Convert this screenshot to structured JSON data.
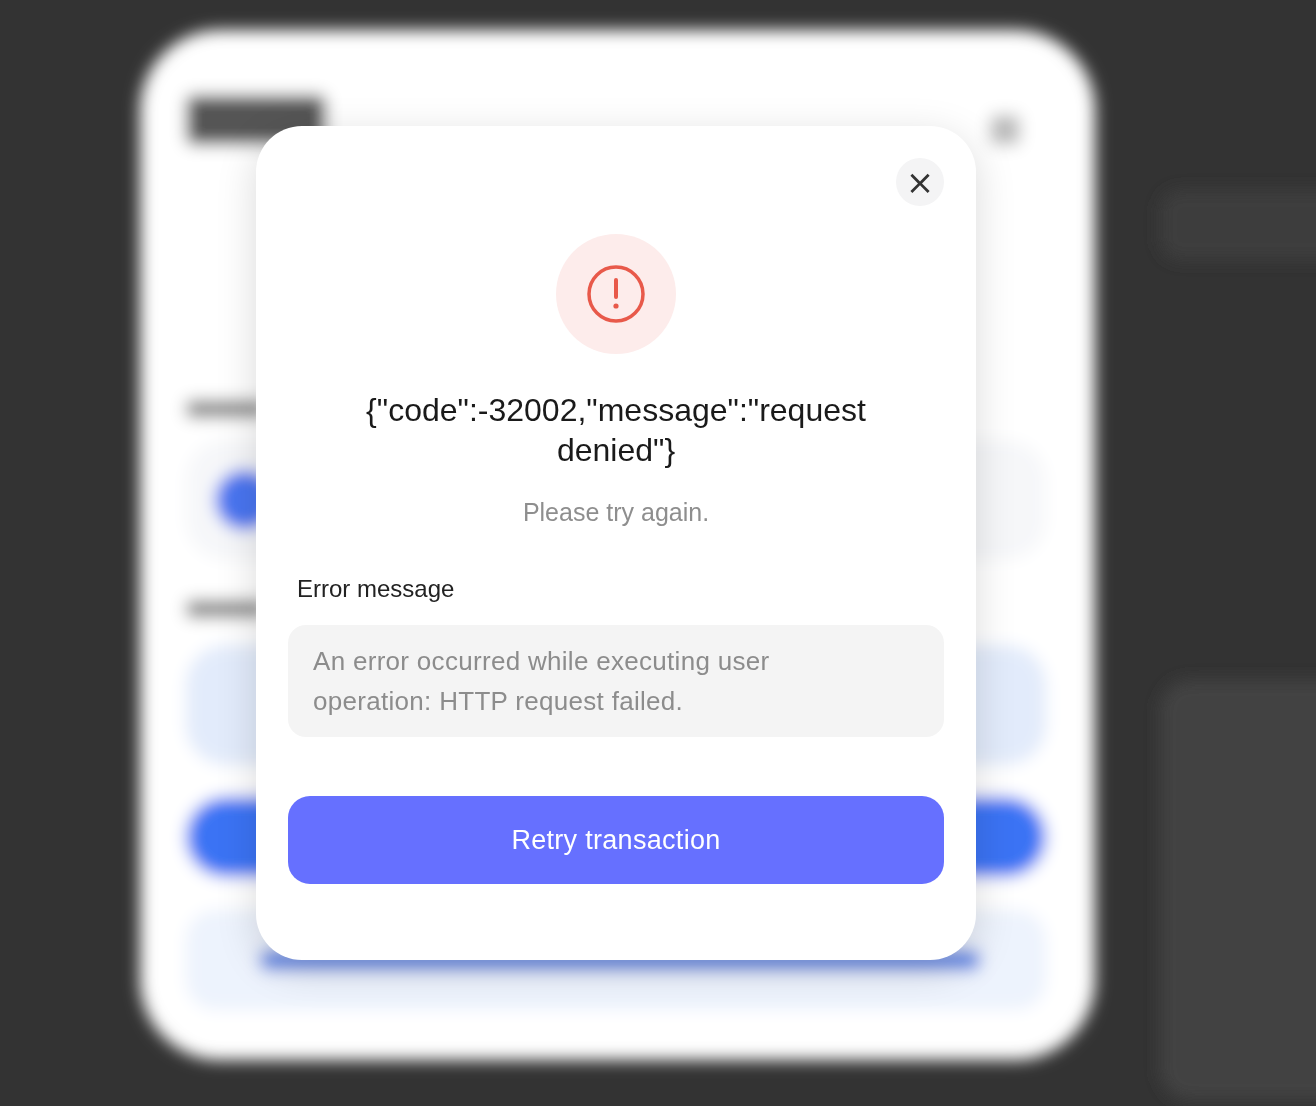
{
  "dialog": {
    "close": "×",
    "title": "{\"code\":-32002,\"message\":\"request denied\"}",
    "subtitle": "Please try again.",
    "field": {
      "label": "Error message",
      "value": "An error occurred while executing user operation: HTTP request failed."
    },
    "button": "Retry transaction"
  }
}
